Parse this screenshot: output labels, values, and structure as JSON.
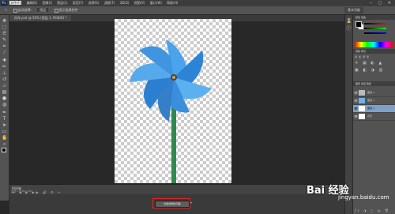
{
  "menubar": {
    "logo": "Ps",
    "items": [
      "文件(F)",
      "编辑(E)",
      "图像(I)",
      "图层(L)",
      "类型(Y)",
      "选择(S)",
      "滤镜(T)",
      "3D(D)",
      "视图(V)",
      "窗口(W)",
      "帮助(H)"
    ],
    "window_controls": "‒ ▢ ✕"
  },
  "options_bar": {
    "items": [
      "↖",
      "自动选择:",
      "图层",
      "显示变换控件"
    ],
    "workspace": "基本功能"
  },
  "document": {
    "tab_title": "风车.psd @ 50% (图层 1, RGB/8) *",
    "status": "文档:1.25M/9.48M"
  },
  "timeline": {
    "title": "时间轴",
    "controls": "⏮ ◀ ▶ ▶▶ 🔊 ⚙ ✂",
    "create_button": "创建视频时间轴",
    "dropdown": "▾"
  },
  "right_panel": {
    "color_tabs": "颜色 色板",
    "adjust_tabs": "调整 样式",
    "adjust_heading": "添加调整",
    "layers_tabs": "图层 通道 路径",
    "layers": [
      {
        "name": "图层 2",
        "visible": "👁"
      },
      {
        "name": "图层 1",
        "visible": "👁"
      },
      {
        "name": "图层 1",
        "visible": "👁"
      },
      {
        "name": "背景",
        "visible": "👁"
      }
    ],
    "layer_actions": "ƒx ◑ ▢ ▤ 🗑"
  },
  "watermark": {
    "brand": "Bai 经验",
    "url": "jingyan.baidu.com"
  },
  "colors": {
    "accent_red": "#e02424",
    "selected_layer": "#7da0c8",
    "pinwheel_blue": "#3a8fdc",
    "stick_green": "#2f8a4e"
  },
  "icons": [
    "move-tool-icon",
    "marquee-icon",
    "lasso-icon",
    "quick-select-icon",
    "crop-icon",
    "eyedropper-icon",
    "healing-icon",
    "brush-icon",
    "stamp-icon",
    "history-brush-icon",
    "eraser-icon",
    "gradient-icon",
    "blur-icon",
    "dodge-icon",
    "pen-icon",
    "type-icon",
    "path-select-icon",
    "shape-icon",
    "hand-icon",
    "zoom-icon"
  ]
}
